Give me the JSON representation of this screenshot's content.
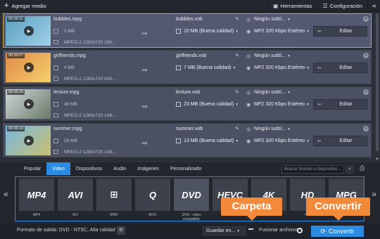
{
  "toolbar": {
    "add_media": "Agregar medio",
    "tools": "Herramientas",
    "settings": "Configuración"
  },
  "files": [
    {
      "time": "00:00:11",
      "name": "bubbles.mpg",
      "size": "3 MB",
      "info": "MPEG-2 1280x720 168...",
      "out_name": "bubbles.vob",
      "quality": "10 MB (Buena calidad)",
      "subtitle": "Ningún subtí...",
      "audio": "MP2 320 Kbps Estéreo",
      "edit": "Editar",
      "selected": true,
      "thumb_colors": [
        "#5aa0c0",
        "#9fd0e8"
      ]
    },
    {
      "time": "00:00:07",
      "name": "girlfriends.mpg",
      "size": "4 MB",
      "info": "MPEG-2 1280x720 435...",
      "out_name": "girlfriends.vob",
      "quality": "7 MB (Buena calidad)",
      "subtitle": "Ningún subtí...",
      "audio": "MP2 320 Kbps Estéreo",
      "edit": "Editar",
      "selected": false,
      "thumb_colors": [
        "#e08a4a",
        "#f5d06a"
      ]
    },
    {
      "time": "00:00:26",
      "name": "lecture.mpg",
      "size": "48 MB",
      "info": "MPEG-2 1280x720 148...",
      "out_name": "lecture.vob",
      "quality": "23 MB (Buena calidad)",
      "subtitle": "Ningún subtí...",
      "audio": "MP2 320 Kbps Estéreo",
      "edit": "Editar",
      "selected": false,
      "thumb_colors": [
        "#cfd8d8",
        "#6a7a6a"
      ]
    },
    {
      "time": "00:00:19",
      "name": "summer.mpg",
      "size": "28 MB",
      "info": "MPEG-2 1280x720 148...",
      "out_name": "summer.vob",
      "quality": "13 MB (Buena calidad)",
      "subtitle": "Ningún subtí...",
      "audio": "MP2 320 Kbps Estéreo",
      "edit": "Editar",
      "selected": false,
      "thumb_colors": [
        "#78b8e0",
        "#c8c070"
      ]
    }
  ],
  "format_tabs": [
    "Popular",
    "Video",
    "Dispositivos",
    "Audio",
    "Imágenes",
    "Personalizado"
  ],
  "active_tab": "Video",
  "search_placeholder": "Buscar formato o dispositivo...",
  "formats": [
    {
      "logo": "MP4",
      "caption": "MP4"
    },
    {
      "logo": "AVI",
      "caption": "AVI"
    },
    {
      "logo": "⊞",
      "caption": "WMV"
    },
    {
      "logo": "Q",
      "caption": "MOV"
    },
    {
      "logo": "DVD",
      "caption": "DVD - video compatible",
      "selected": true
    },
    {
      "logo": "HEVC",
      "caption": "HEVC"
    },
    {
      "logo": "4K",
      "caption": "4K"
    },
    {
      "logo": "HD",
      "caption": "HD"
    },
    {
      "logo": "MPG",
      "caption": "MPEG"
    }
  ],
  "bottom": {
    "output_format": "Formato de salida: DVD - NTSC, Alta calidad",
    "save_to": "Guardar en...",
    "merge": "Fusionar archivos",
    "convert": "Convertir"
  },
  "callouts": {
    "folder": "Carpeta",
    "convert": "Convertir"
  },
  "colors": {
    "accent": "#2b8be0",
    "callout": "#f38a3a",
    "selected_border": "#c9a54a"
  }
}
